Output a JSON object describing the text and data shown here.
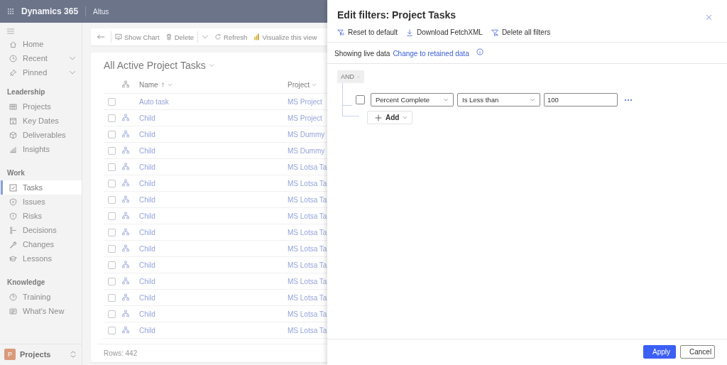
{
  "header": {
    "app_title": "Dynamics 365",
    "context": "Altus"
  },
  "sidebar": {
    "sections": [
      {
        "items": [
          {
            "label": "Home",
            "selected": false,
            "expandable": false
          },
          {
            "label": "Recent",
            "selected": false,
            "expandable": true
          },
          {
            "label": "Pinned",
            "selected": false,
            "expandable": true
          }
        ]
      },
      {
        "heading": "Leadership",
        "items": [
          {
            "label": "Projects",
            "selected": false
          },
          {
            "label": "Key Dates",
            "selected": false
          },
          {
            "label": "Deliverables",
            "selected": false
          },
          {
            "label": "Insights",
            "selected": false
          }
        ]
      },
      {
        "heading": "Work",
        "items": [
          {
            "label": "Tasks",
            "selected": true
          },
          {
            "label": "Issues",
            "selected": false
          },
          {
            "label": "Risks",
            "selected": false
          },
          {
            "label": "Decisions",
            "selected": false
          },
          {
            "label": "Changes",
            "selected": false
          },
          {
            "label": "Lessons",
            "selected": false
          }
        ]
      },
      {
        "heading": "Knowledge",
        "items": [
          {
            "label": "Training",
            "selected": false
          },
          {
            "label": "What's New",
            "selected": false
          }
        ]
      }
    ],
    "footer": {
      "avatar": "P",
      "label": "Projects"
    }
  },
  "commands": [
    {
      "label": "Show Chart",
      "kind": "button"
    },
    {
      "label": "Delete",
      "kind": "split"
    },
    {
      "label": "Refresh",
      "kind": "button"
    },
    {
      "label": "Visualize this view",
      "kind": "button"
    }
  ],
  "view": {
    "title": "All Active Project Tasks",
    "columns": [
      {
        "label": "Name",
        "sorted": true
      },
      {
        "label": "Project",
        "sorted": false
      }
    ],
    "rows": [
      {
        "name": "Auto task",
        "project": "MS Project",
        "hierarchy": false,
        "checked": false
      },
      {
        "name": "Child",
        "project": "MS Project",
        "hierarchy": true,
        "checked": false
      },
      {
        "name": "Child",
        "project": "MS Dummy",
        "hierarchy": true,
        "checked": false
      },
      {
        "name": "Child",
        "project": "MS Dummy",
        "hierarchy": true,
        "checked": false
      },
      {
        "name": "Child",
        "project": "MS Lotsa Ta",
        "hierarchy": true,
        "checked": false
      },
      {
        "name": "Child",
        "project": "MS Lotsa Ta",
        "hierarchy": true,
        "checked": false
      },
      {
        "name": "Child",
        "project": "MS Lotsa Ta",
        "hierarchy": true,
        "checked": false
      },
      {
        "name": "Child",
        "project": "MS Lotsa Ta",
        "hierarchy": true,
        "checked": false
      },
      {
        "name": "Child",
        "project": "MS Lotsa Ta",
        "hierarchy": true,
        "checked": false
      },
      {
        "name": "Child",
        "project": "MS Lotsa Ta",
        "hierarchy": true,
        "checked": false
      },
      {
        "name": "Child",
        "project": "MS Lotsa Ta",
        "hierarchy": true,
        "checked": false
      },
      {
        "name": "Child",
        "project": "MS Lotsa Ta",
        "hierarchy": true,
        "checked": false
      },
      {
        "name": "Child",
        "project": "MS Lotsa Ta",
        "hierarchy": true,
        "checked": false
      },
      {
        "name": "Child",
        "project": "MS Lotsa Ta",
        "hierarchy": true,
        "checked": false
      },
      {
        "name": "Child",
        "project": "MS Lotsa Ta",
        "hierarchy": true,
        "checked": false
      }
    ],
    "row_count": "Rows: 442"
  },
  "panel": {
    "title": "Edit filters: Project Tasks",
    "actions": [
      "Reset to default",
      "Download FetchXML",
      "Delete all filters"
    ],
    "data_mode": {
      "text": "Showing live data",
      "link": "Change to retained data"
    },
    "group": {
      "operator": "AND",
      "disabled": true
    },
    "conditions": [
      {
        "checked": false,
        "field": "Percent Complete",
        "operator": "Is Less than",
        "value": "100"
      }
    ],
    "add_label": "Add",
    "buttons": [
      {
        "label": "Apply",
        "primary": true
      },
      {
        "label": "Cancel",
        "primary": false
      }
    ]
  }
}
